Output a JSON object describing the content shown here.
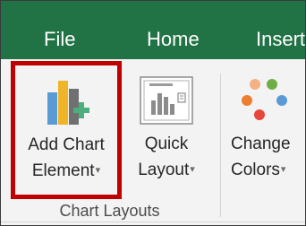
{
  "tabs": [
    "File",
    "Home",
    "Insert"
  ],
  "ribbon": {
    "add_chart_element": {
      "line1": "Add Chart",
      "line2": "Element",
      "caret": "▾"
    },
    "quick_layout": {
      "line1": "Quick",
      "line2": "Layout",
      "caret": "▾"
    },
    "change_colors": {
      "line1": "Change",
      "line2": "Colors",
      "caret": "▾"
    },
    "group_label": "Chart Layouts"
  },
  "colors": {
    "tab_bar": "#217346",
    "highlight": "#c00000"
  }
}
